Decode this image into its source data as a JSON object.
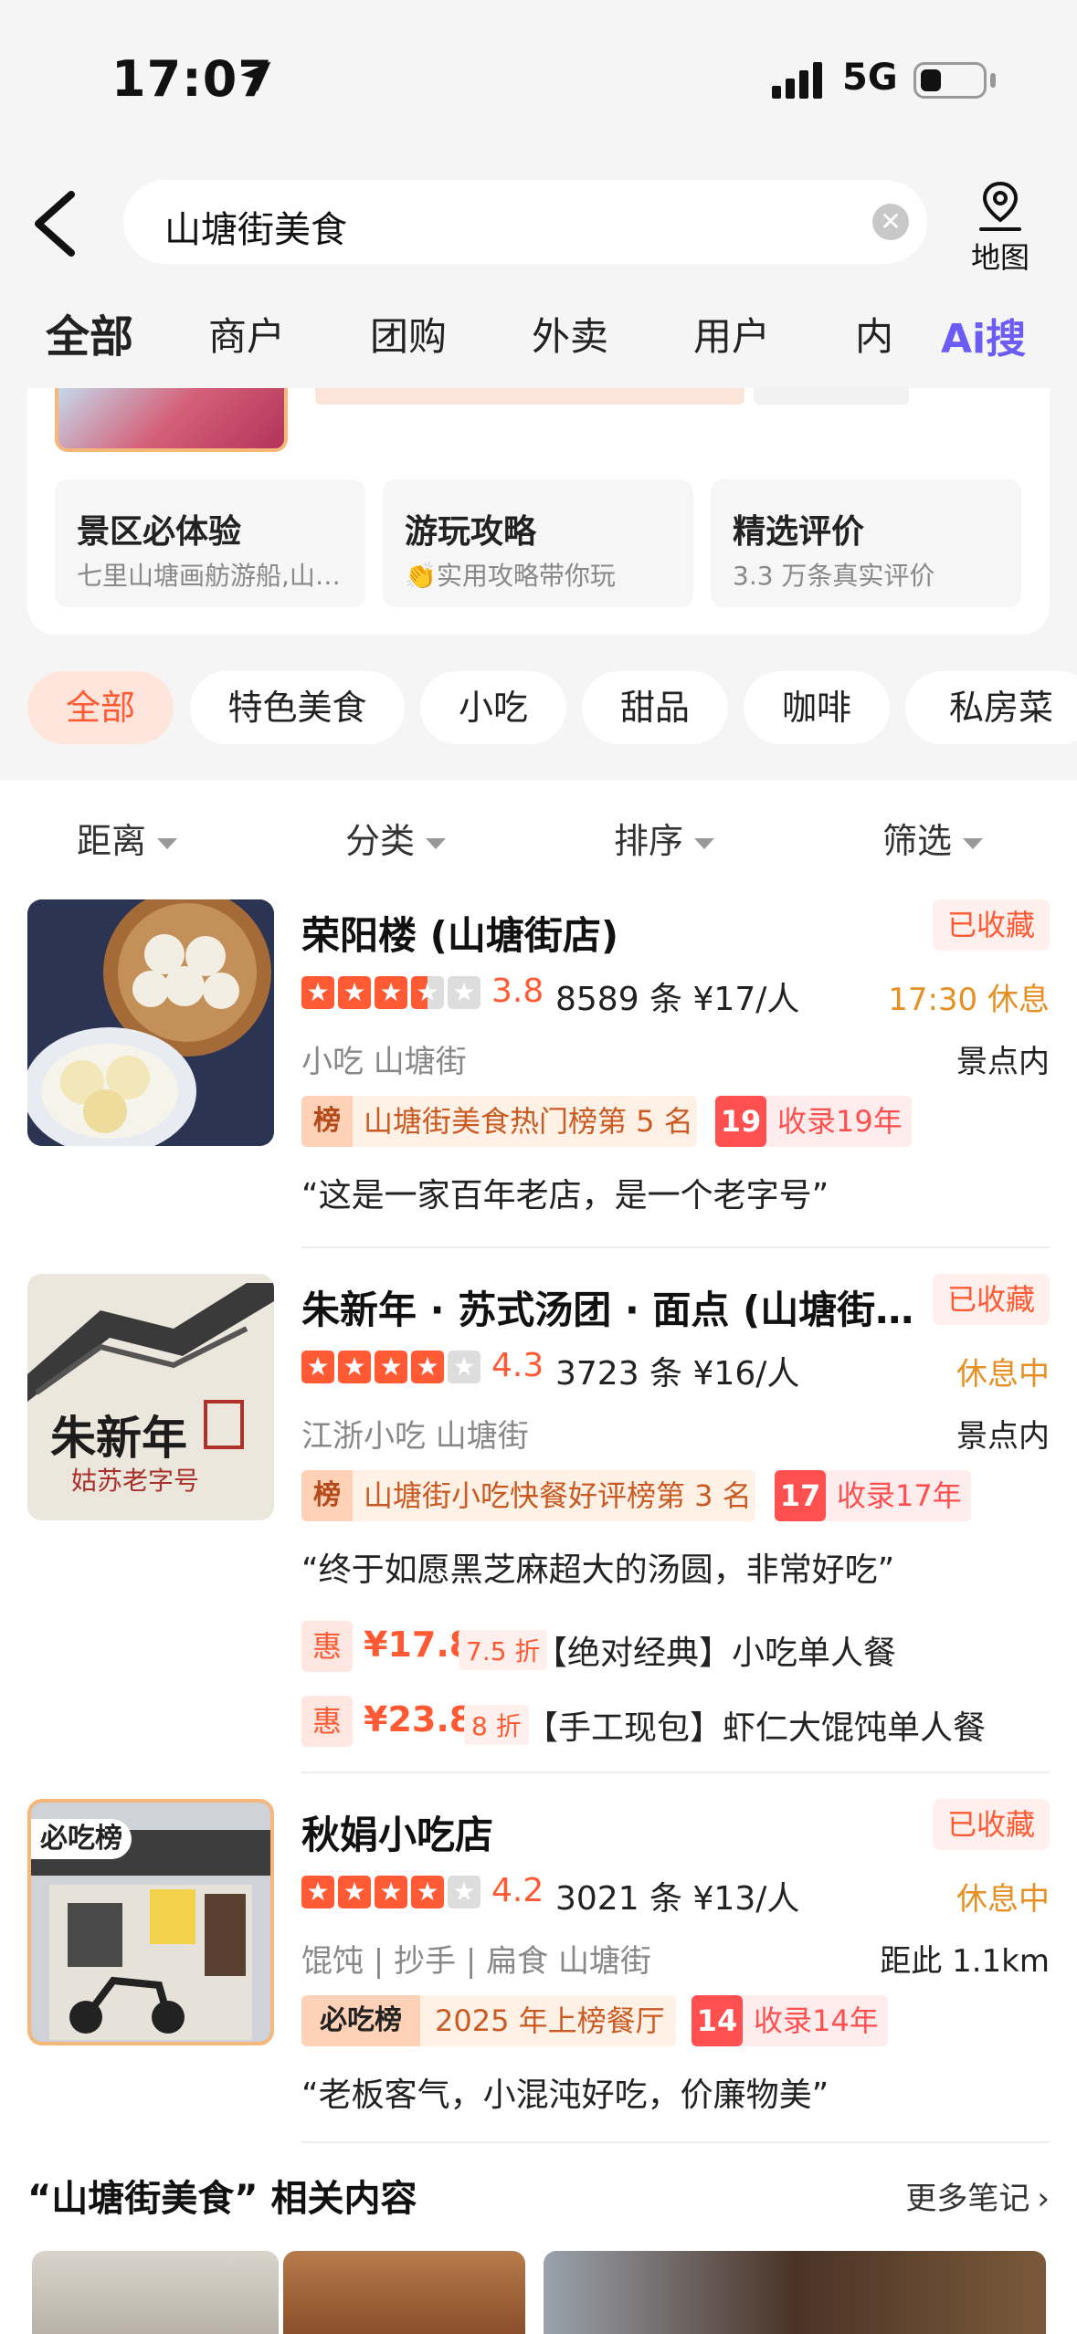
{
  "status_bar": {
    "time": "17:07",
    "network": "5G"
  },
  "search": {
    "query": "山塘街美食",
    "map_label": "地图"
  },
  "tabs": [
    {
      "label": "全部",
      "active": true
    },
    {
      "label": "商户"
    },
    {
      "label": "团购"
    },
    {
      "label": "外卖"
    },
    {
      "label": "用户"
    },
    {
      "label": "内"
    }
  ],
  "ai_search_label": "Ai搜",
  "mini_cards": [
    {
      "title": "景区必体验",
      "sub": "七里山塘画舫游船,山…"
    },
    {
      "title": "游玩攻略",
      "sub": "👏实用攻略带你玩"
    },
    {
      "title": "精选评价",
      "sub": "3.3 万条真实评价"
    }
  ],
  "chips": [
    {
      "label": "全部",
      "active": true
    },
    {
      "label": "特色美食"
    },
    {
      "label": "小吃"
    },
    {
      "label": "甜品"
    },
    {
      "label": "咖啡"
    },
    {
      "label": "私房菜"
    }
  ],
  "filters": [
    "距离",
    "分类",
    "排序",
    "筛选"
  ],
  "shops": [
    {
      "name": "荣阳楼 (山塘街店)",
      "fav": "已收藏",
      "rating": 3.8,
      "score": "3.8",
      "reviews": "8589 条  ¥17/人",
      "status": "17:30 休息",
      "category": "小吃  山塘街",
      "distance": "景点内",
      "rank_badge": "榜",
      "rank_text": "山塘街美食热门榜第 5 名",
      "years_num": "19",
      "years_text": "收录19年",
      "quote": "“这是一家百年老店，是一个老字号”"
    },
    {
      "name": "朱新年 · 苏式汤团 · 面点 (山塘街…",
      "fav": "已收藏",
      "rating": 4.3,
      "score": "4.3",
      "reviews": "3723 条  ¥16/人",
      "status": "休息中",
      "category": "江浙小吃  山塘街",
      "distance": "景点内",
      "rank_badge": "榜",
      "rank_text": "山塘街小吃快餐好评榜第 3 名",
      "years_num": "17",
      "years_text": "收录17年",
      "quote": "“终于如愿黑芝麻超大的汤圆，非常好吃”",
      "logo_main": "朱新年",
      "logo_sub": "姑苏老字号",
      "deals": [
        {
          "tag": "惠",
          "price": "¥17.8",
          "discount": "7.5 折",
          "desc": "【绝对经典】小吃单人餐"
        },
        {
          "tag": "惠",
          "price": "¥23.8",
          "discount": "8 折",
          "desc": "【手工现包】虾仁大馄饨单人餐"
        }
      ]
    },
    {
      "name": "秋娟小吃店",
      "fav": "已收藏",
      "rating": 4.2,
      "score": "4.2",
      "reviews": "3021 条  ¥13/人",
      "status": "休息中",
      "category": "馄饨 | 抄手 | 扁食  山塘街",
      "distance": "距此 1.1km",
      "rank_badge": "必吃榜",
      "rank_text": "2025 年上榜餐厅",
      "years_num": "14",
      "years_text": "收录14年",
      "quote": "“老板客气，小混沌好吃，价廉物美”",
      "img_badge": "必吃榜"
    }
  ],
  "related": {
    "title": "“山塘街美食” 相关内容",
    "more": "更多笔记"
  },
  "colors": {
    "accent": "#ff5a33",
    "ai": "#6b5cf6",
    "status_orange": "#e69024"
  }
}
